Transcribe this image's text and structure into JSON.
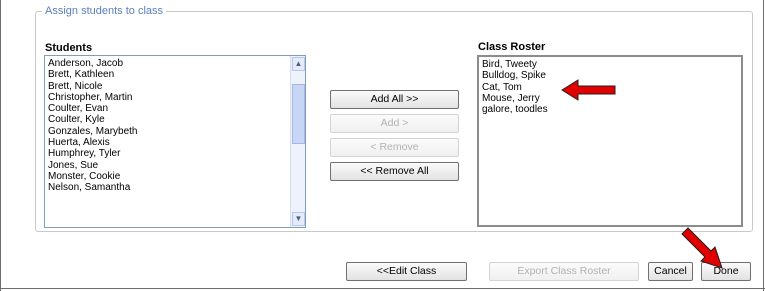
{
  "assign_panel": {
    "legend": "Assign students to class",
    "students_title": "Students",
    "roster_title": "Class Roster"
  },
  "students": [
    "Anderson, Jacob",
    "Brett, Kathleen",
    "Brett, Nicole",
    "Christopher, Martin",
    "Coulter, Evan",
    "Coulter, Kyle",
    "Gonzales, Marybeth",
    "Huerta, Alexis",
    "Humphrey, Tyler",
    "Jones, Sue",
    "Monster, Cookie",
    "Nelson, Samantha"
  ],
  "roster": [
    "Bird, Tweety",
    "Bulldog, Spike",
    "Cat, Tom",
    "Mouse, Jerry",
    "galore, toodles"
  ],
  "transfer_buttons": {
    "add_all": "Add All >>",
    "add": "Add >",
    "remove": "< Remove",
    "remove_all": "<< Remove All"
  },
  "footer_buttons": {
    "edit_class": "<<Edit Class",
    "export_roster": "Export Class Roster",
    "cancel": "Cancel",
    "done": "Done"
  },
  "scrollbar_icons": {
    "up": "chevron-up-icon",
    "down": "chevron-down-icon"
  },
  "colors": {
    "legend": "#5a7fc0",
    "annotation_arrow": "#e00000",
    "scrollbar": "#c8d6f5"
  }
}
